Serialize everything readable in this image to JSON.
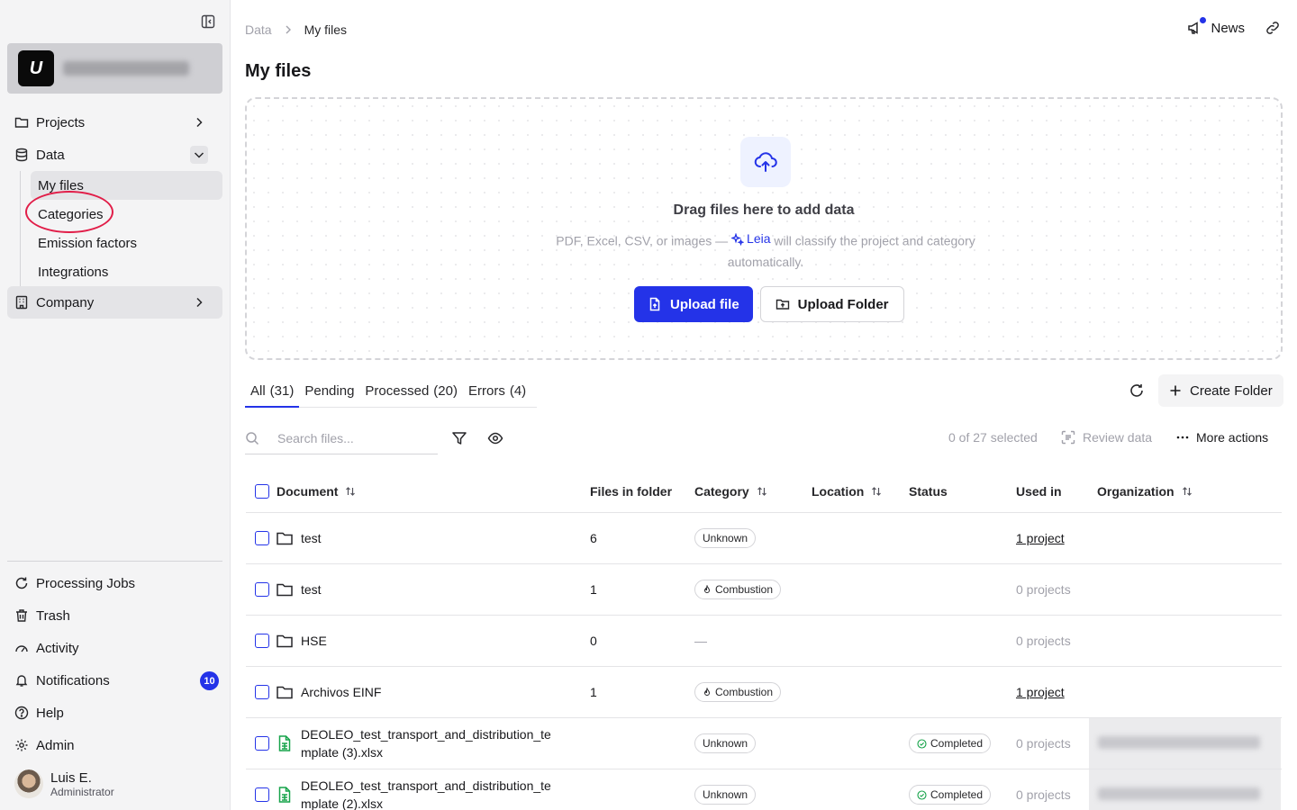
{
  "sidebar": {
    "org_logo_letter": "U",
    "nav": [
      {
        "label": "Projects",
        "icon": "folder-icon"
      },
      {
        "label": "Data",
        "icon": "database-icon"
      },
      {
        "label": "Company",
        "icon": "building-icon"
      }
    ],
    "data_sub": [
      "My files",
      "Categories",
      "Emission factors",
      "Integrations"
    ],
    "bottom": [
      {
        "label": "Processing Jobs",
        "icon": "refresh-icon"
      },
      {
        "label": "Trash",
        "icon": "trash-icon"
      },
      {
        "label": "Activity",
        "icon": "activity-icon"
      },
      {
        "label": "Notifications",
        "icon": "bell-icon",
        "badge": "10"
      },
      {
        "label": "Help",
        "icon": "help-icon"
      },
      {
        "label": "Admin",
        "icon": "gear-icon"
      }
    ],
    "user": {
      "name": "Luis E.",
      "role": "Administrator"
    }
  },
  "header": {
    "breadcrumb": [
      "Data",
      "My files"
    ],
    "news_label": "News",
    "title": "My files"
  },
  "dropzone": {
    "title": "Drag files here to add data",
    "desc_before": "PDF, Excel, CSV, or images —",
    "leia": "Leia",
    "desc_after": "will classify the project and category automatically.",
    "upload_file": "Upload file",
    "upload_folder": "Upload Folder"
  },
  "tabs": [
    {
      "label": "All",
      "count": "(31)"
    },
    {
      "label": "Pending",
      "count": ""
    },
    {
      "label": "Processed",
      "count": "(20)"
    },
    {
      "label": "Errors",
      "count": "(4)"
    }
  ],
  "toolbar": {
    "create_folder": "Create Folder",
    "search_placeholder": "Search files...",
    "selected": "0 of 27 selected",
    "review": "Review data",
    "more": "More actions"
  },
  "table": {
    "headers": {
      "document": "Document",
      "files_in_folder": "Files in folder",
      "category": "Category",
      "location": "Location",
      "status": "Status",
      "used_in": "Used in",
      "organization": "Organization"
    },
    "rows": [
      {
        "name": "test",
        "type": "folder",
        "files": "6",
        "category": "Unknown",
        "status": "",
        "used_in": "1 project"
      },
      {
        "name": "test",
        "type": "folder",
        "files": "1",
        "category": "Combustion",
        "status": "",
        "used_in": "0 projects"
      },
      {
        "name": "HSE",
        "type": "folder",
        "files": "0",
        "category": "—",
        "status": "",
        "used_in": "0 projects"
      },
      {
        "name": "Archivos EINF",
        "type": "folder",
        "files": "1",
        "category": "Combustion",
        "status": "",
        "used_in": "1 project"
      },
      {
        "name": "DEOLEO_test_transport_and_distribution_template (3).xlsx",
        "type": "sheet",
        "files": "",
        "category": "Unknown",
        "status": "Completed",
        "used_in": "0 projects"
      },
      {
        "name": "DEOLEO_test_transport_and_distribution_template (2).xlsx",
        "type": "sheet",
        "files": "",
        "category": "Unknown",
        "status": "Completed",
        "used_in": "0 projects"
      }
    ]
  },
  "colors": {
    "accent": "#2433e8",
    "highlight_circle": "#e11d48",
    "sheet_icon": "#16a34a"
  }
}
